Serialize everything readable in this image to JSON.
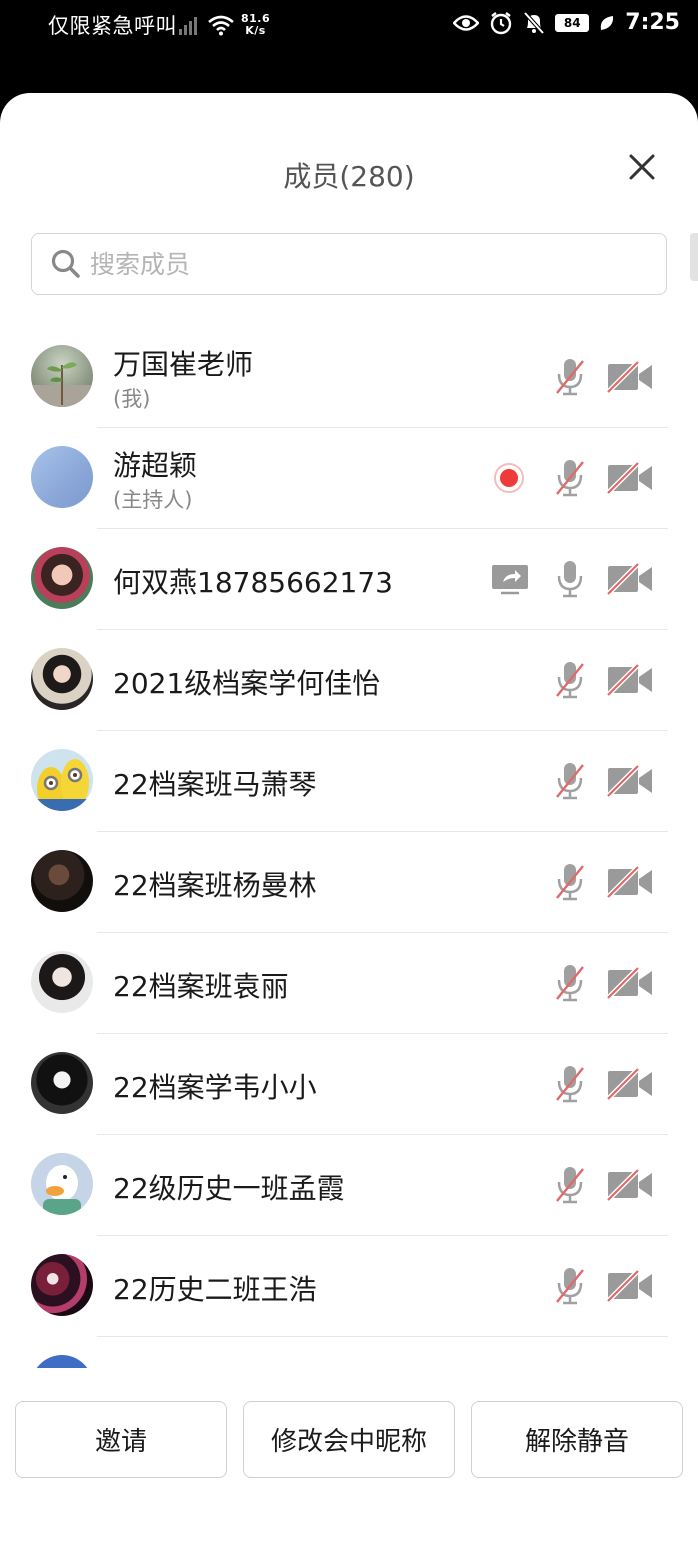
{
  "status_bar": {
    "carrier": "仅限紧急呼叫",
    "net_speed_value": "81.6",
    "net_speed_unit": "K/s",
    "battery": "84",
    "time": "7:25"
  },
  "sheet": {
    "title": "成员(280)",
    "search_placeholder": "搜索成员"
  },
  "members": [
    {
      "name": "万国崔老师",
      "sub": "(我)",
      "mic": "muted",
      "cam": "off",
      "avatar": "plant-photo"
    },
    {
      "name": "游超颖",
      "sub": "(主持人)",
      "recording": true,
      "mic": "muted",
      "cam": "off",
      "avatar": "blue-gradient"
    },
    {
      "name": "何双燕18785662173",
      "sharing": true,
      "mic": "on",
      "cam": "off",
      "avatar": "girl-colorful-photo"
    },
    {
      "name": "2021级档案学何佳怡",
      "mic": "muted",
      "cam": "off",
      "avatar": "girl-photo"
    },
    {
      "name": "22档案班马萧琴",
      "mic": "muted",
      "cam": "off",
      "avatar": "minions"
    },
    {
      "name": "22档案班杨曼林",
      "mic": "muted",
      "cam": "off",
      "avatar": "dark-photo"
    },
    {
      "name": "22档案班袁丽",
      "mic": "muted",
      "cam": "off",
      "avatar": "anime-girl-dark"
    },
    {
      "name": "22档案学韦小小",
      "mic": "muted",
      "cam": "off",
      "avatar": "anime-bw"
    },
    {
      "name": "22级历史一班孟霞",
      "mic": "muted",
      "cam": "off",
      "avatar": "duck-cartoon"
    },
    {
      "name": "22历史二班王浩",
      "mic": "muted",
      "cam": "off",
      "avatar": "anime-group"
    }
  ],
  "buttons": {
    "invite": "邀请",
    "rename": "修改会中昵称",
    "unmute": "解除静音"
  },
  "colors": {
    "muted_slash": "#e06a6a",
    "icon_gray": "#9a9a9a",
    "record_red": "#f03a3a"
  }
}
